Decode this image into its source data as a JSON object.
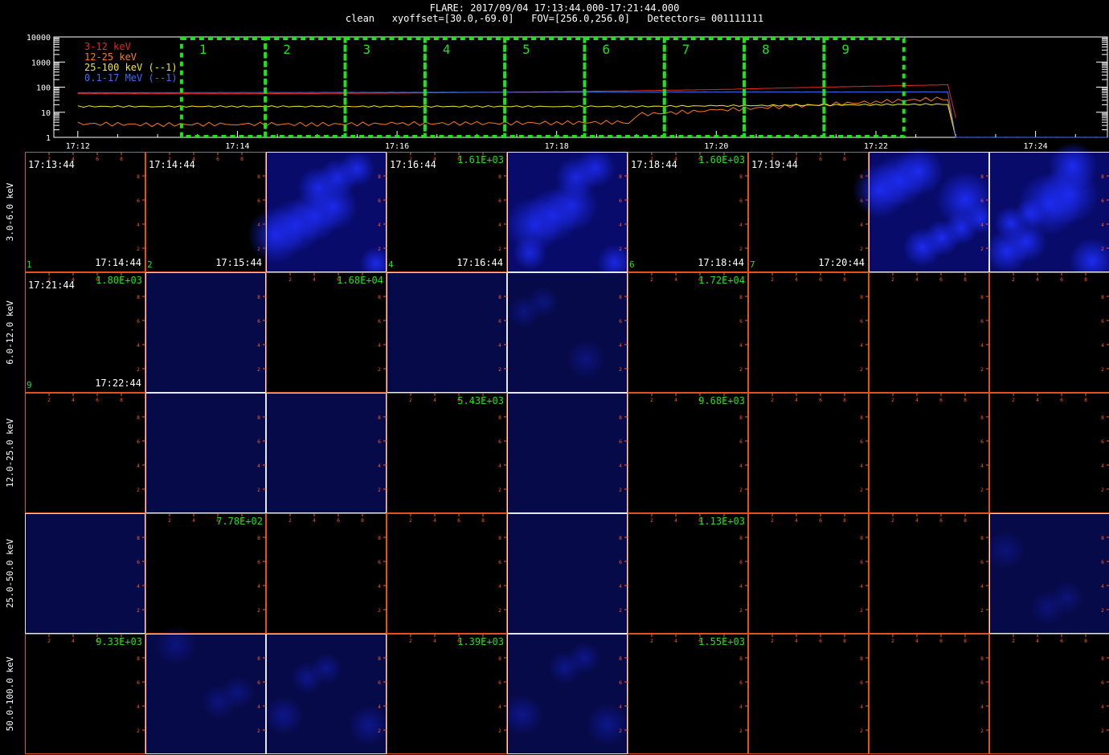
{
  "header": {
    "line1": "FLARE: 2017/09/04 17:13:44.000-17:21:44.000",
    "line2": "clean   xyoffset=[30.0,-69.0]   FOV=[256.0,256.0]   Detectors= 001111111"
  },
  "chart_data": [
    {
      "type": "line",
      "title": "",
      "xlabel": "",
      "ylabel": "",
      "y_scale": "log",
      "ylim": [
        1,
        10000
      ],
      "y_ticks": [
        "10000",
        "1000",
        "100",
        "10",
        "1"
      ],
      "x_ticks": [
        "17:12",
        "17:14",
        "17:16",
        "17:18",
        "17:20",
        "17:22",
        "17:24"
      ],
      "x_minutes": [
        0,
        2,
        4,
        6,
        8,
        10,
        12
      ],
      "xlim_minutes": [
        -0.3,
        12.9
      ],
      "grid": false,
      "legend": "top-left",
      "series": [
        {
          "name": "3-12 keV",
          "color": "#e8281e",
          "x": [
            0,
            1,
            2,
            3,
            4,
            5,
            6,
            7,
            8,
            9,
            10,
            10.9,
            11.0
          ],
          "y": [
            55,
            55,
            55,
            56,
            58,
            62,
            66,
            72,
            80,
            95,
            110,
            125,
            6
          ]
        },
        {
          "name": "12-25 keV",
          "color": "#ff7a1c",
          "x": [
            0,
            1,
            2,
            3,
            4,
            5,
            6,
            6.9,
            7,
            8,
            9,
            10,
            10.9,
            11.0
          ],
          "y": [
            3.5,
            3.2,
            3.4,
            3.3,
            3.5,
            3.6,
            3.8,
            4.0,
            8,
            12,
            18,
            26,
            36,
            1
          ]
        },
        {
          "name": "25-100 keV (--1)",
          "color": "#f2e81e",
          "x": [
            0,
            1,
            2,
            3,
            4,
            5,
            6,
            7,
            8,
            9,
            10,
            10.9,
            11.0
          ],
          "y": [
            17,
            17,
            17,
            17,
            17,
            17,
            17,
            17,
            18,
            19,
            20,
            21,
            1
          ]
        },
        {
          "name": "0.1-17 MeV (--1)",
          "color": "#3b6ff0",
          "x": [
            0,
            2,
            4,
            6,
            8,
            10,
            10.9,
            11.0,
            12.9
          ],
          "y": [
            60,
            61,
            62,
            63,
            64,
            64,
            65,
            1,
            1
          ]
        }
      ],
      "intervals": [
        {
          "label": "1",
          "x0": 1.3,
          "x1": 2.35
        },
        {
          "label": "2",
          "x0": 2.35,
          "x1": 3.35
        },
        {
          "label": "3",
          "x0": 3.35,
          "x1": 4.35
        },
        {
          "label": "4",
          "x0": 4.35,
          "x1": 5.35
        },
        {
          "label": "5",
          "x0": 5.35,
          "x1": 6.35
        },
        {
          "label": "6",
          "x0": 6.35,
          "x1": 7.35
        },
        {
          "label": "7",
          "x0": 7.35,
          "x1": 8.35
        },
        {
          "label": "8",
          "x0": 8.35,
          "x1": 9.35
        },
        {
          "label": "9",
          "x0": 9.35,
          "x1": 10.35
        }
      ],
      "interval_color": "#22e01e"
    },
    {
      "type": "heatmap",
      "rows": [
        "3.0-6.0 keV",
        "6.0-12.0 keV",
        "12.0-25.0 keV",
        "25.0-50.0 keV",
        "50.0-100.0 keV"
      ],
      "axis_ticks": [
        "2",
        "4",
        "6",
        "8"
      ],
      "axis_color": "#ff5a1e",
      "frame_color": "#ffffff",
      "cells": [
        [
          {
            "time_start": "17:13:44",
            "time_end": "17:14:44",
            "index": "1",
            "max": "",
            "intensity": 0
          },
          {
            "time_start": "17:14:44",
            "time_end": "17:15:44",
            "index": "2",
            "max": "",
            "intensity": 0
          },
          {
            "time_start": "",
            "time_end": "",
            "index": "",
            "max": "",
            "intensity": 0.85
          },
          {
            "time_start": "17:16:44",
            "time_end": "17:16:44",
            "index": "4",
            "max": "1.61E+03",
            "intensity": 0
          },
          {
            "time_start": "",
            "time_end": "",
            "index": "",
            "max": "",
            "intensity": 0.8
          },
          {
            "time_start": "17:18:44",
            "time_end": "17:18:44",
            "index": "6",
            "max": "1.60E+03",
            "intensity": 0
          },
          {
            "time_start": "17:19:44",
            "time_end": "17:20:44",
            "index": "7",
            "max": "",
            "intensity": 0
          },
          {
            "time_start": "",
            "time_end": "",
            "index": "",
            "max": "",
            "intensity": 0.9
          },
          {
            "time_start": "",
            "time_end": "",
            "index": "",
            "max": "",
            "intensity": 0.9
          }
        ],
        [
          {
            "time_start": "17:21:44",
            "time_end": "17:22:44",
            "index": "9",
            "max": "1.80E+03",
            "intensity": 0
          },
          {
            "time_start": "",
            "time_end": "",
            "index": "",
            "max": "",
            "intensity": 0.2
          },
          {
            "time_start": "",
            "time_end": "",
            "index": "",
            "max": "1.68E+04",
            "intensity": 0
          },
          {
            "time_start": "",
            "time_end": "",
            "index": "",
            "max": "",
            "intensity": 0.2
          },
          {
            "time_start": "",
            "time_end": "",
            "index": "",
            "max": "",
            "intensity": 0.35
          },
          {
            "time_start": "",
            "time_end": "",
            "index": "",
            "max": "1.72E+04",
            "intensity": 0
          },
          {
            "time_start": "",
            "time_end": "",
            "index": "",
            "max": "",
            "intensity": 0
          },
          {
            "time_start": "",
            "time_end": "",
            "index": "",
            "max": "",
            "intensity": 0
          },
          {
            "time_start": "",
            "time_end": "",
            "index": "",
            "max": "",
            "intensity": 0
          }
        ],
        [
          {
            "time_start": "",
            "time_end": "",
            "index": "",
            "max": "",
            "intensity": 0
          },
          {
            "time_start": "",
            "time_end": "",
            "index": "",
            "max": "",
            "intensity": 0.25
          },
          {
            "time_start": "",
            "time_end": "",
            "index": "",
            "max": "",
            "intensity": 0.25
          },
          {
            "time_start": "",
            "time_end": "",
            "index": "",
            "max": "5.43E+03",
            "intensity": 0
          },
          {
            "time_start": "",
            "time_end": "",
            "index": "",
            "max": "",
            "intensity": 0.25
          },
          {
            "time_start": "",
            "time_end": "",
            "index": "",
            "max": "9.68E+03",
            "intensity": 0
          },
          {
            "time_start": "",
            "time_end": "",
            "index": "",
            "max": "",
            "intensity": 0
          },
          {
            "time_start": "",
            "time_end": "",
            "index": "",
            "max": "",
            "intensity": 0
          },
          {
            "time_start": "",
            "time_end": "",
            "index": "",
            "max": "",
            "intensity": 0
          }
        ],
        [
          {
            "time_start": "",
            "time_end": "",
            "index": "",
            "max": "",
            "intensity": 0.2
          },
          {
            "time_start": "",
            "time_end": "",
            "index": "",
            "max": "7.78E+02",
            "intensity": 0
          },
          {
            "time_start": "",
            "time_end": "",
            "index": "",
            "max": "",
            "intensity": 0
          },
          {
            "time_start": "",
            "time_end": "",
            "index": "",
            "max": "",
            "intensity": 0
          },
          {
            "time_start": "",
            "time_end": "",
            "index": "",
            "max": "",
            "intensity": 0.2
          },
          {
            "time_start": "",
            "time_end": "",
            "index": "",
            "max": "1.13E+03",
            "intensity": 0
          },
          {
            "time_start": "",
            "time_end": "",
            "index": "",
            "max": "",
            "intensity": 0
          },
          {
            "time_start": "",
            "time_end": "",
            "index": "",
            "max": "",
            "intensity": 0
          },
          {
            "time_start": "",
            "time_end": "",
            "index": "",
            "max": "",
            "intensity": 0.3
          }
        ],
        [
          {
            "time_start": "",
            "time_end": "",
            "index": "",
            "max": "9.33E+03",
            "intensity": 0
          },
          {
            "time_start": "",
            "time_end": "",
            "index": "",
            "max": "",
            "intensity": 0.35
          },
          {
            "time_start": "",
            "time_end": "",
            "index": "",
            "max": "",
            "intensity": 0.45
          },
          {
            "time_start": "",
            "time_end": "",
            "index": "",
            "max": "1.39E+03",
            "intensity": 0
          },
          {
            "time_start": "",
            "time_end": "",
            "index": "",
            "max": "",
            "intensity": 0.45
          },
          {
            "time_start": "",
            "time_end": "",
            "index": "",
            "max": "1.55E+03",
            "intensity": 0
          },
          {
            "time_start": "",
            "time_end": "",
            "index": "",
            "max": "",
            "intensity": 0
          },
          {
            "time_start": "",
            "time_end": "",
            "index": "",
            "max": "",
            "intensity": 0
          },
          {
            "time_start": "",
            "time_end": "",
            "index": "",
            "max": "",
            "intensity": 0
          }
        ]
      ]
    }
  ]
}
